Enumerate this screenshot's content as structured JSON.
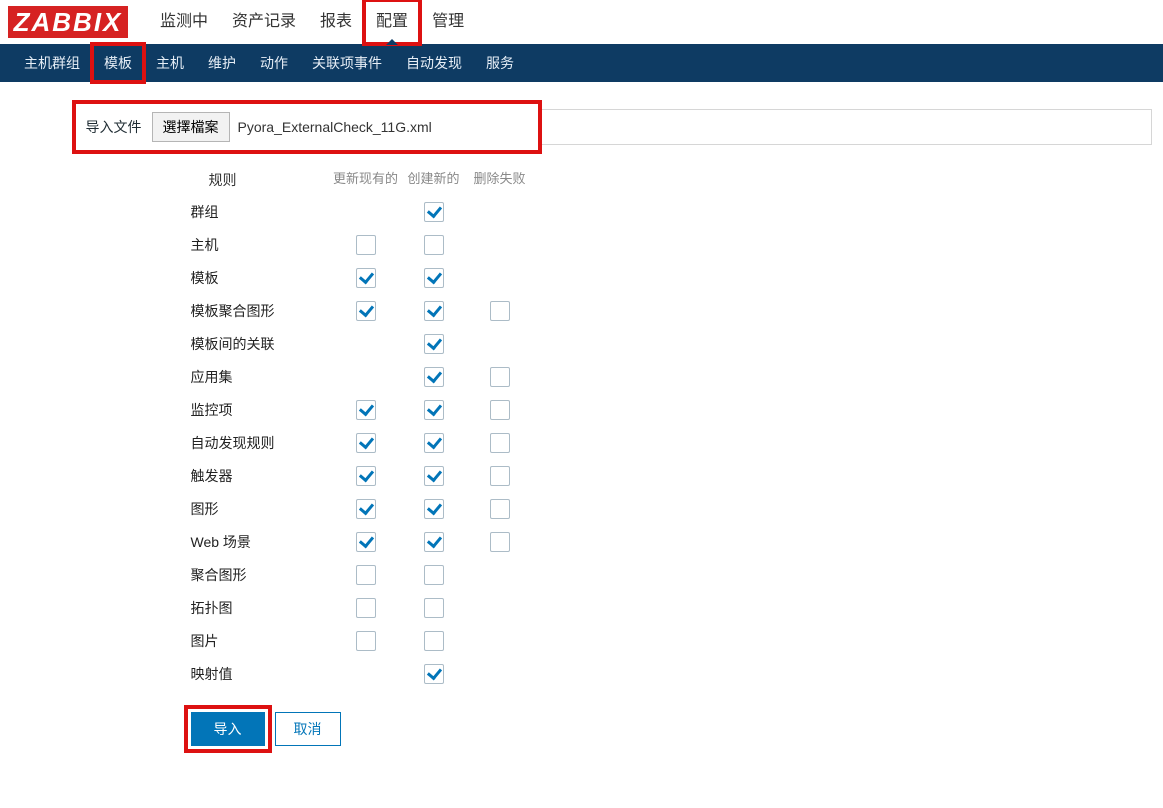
{
  "logo": "ZABBIX",
  "topnav": {
    "items": [
      "监测中",
      "资产记录",
      "报表",
      "配置",
      "管理"
    ],
    "activeIndex": 3,
    "highlightIndex": 3
  },
  "subnav": {
    "items": [
      "主机群组",
      "模板",
      "主机",
      "维护",
      "动作",
      "关联项事件",
      "自动发现",
      "服务"
    ],
    "highlightIndex": 1
  },
  "form": {
    "fileLabel": "导入文件",
    "chooseFileBtn": "選擇檔案",
    "chosenFileName": "Pyora_ExternalCheck_11G.xml",
    "rulesLabel": "规则",
    "headers": {
      "update": "更新现有的",
      "create": "创建新的",
      "delete": "删除失败"
    },
    "rules": [
      {
        "name": "群组",
        "update": null,
        "create": true,
        "delete": null
      },
      {
        "name": "主机",
        "update": false,
        "create": false,
        "delete": null
      },
      {
        "name": "模板",
        "update": true,
        "create": true,
        "delete": null
      },
      {
        "name": "模板聚合图形",
        "update": true,
        "create": true,
        "delete": false
      },
      {
        "name": "模板间的关联",
        "update": null,
        "create": true,
        "delete": null
      },
      {
        "name": "应用集",
        "update": null,
        "create": true,
        "delete": false
      },
      {
        "name": "监控项",
        "update": true,
        "create": true,
        "delete": false
      },
      {
        "name": "自动发现规则",
        "update": true,
        "create": true,
        "delete": false
      },
      {
        "name": "触发器",
        "update": true,
        "create": true,
        "delete": false
      },
      {
        "name": "图形",
        "update": true,
        "create": true,
        "delete": false
      },
      {
        "name": "Web 场景",
        "update": true,
        "create": true,
        "delete": false
      },
      {
        "name": "聚合图形",
        "update": false,
        "create": false,
        "delete": null
      },
      {
        "name": "拓扑图",
        "update": false,
        "create": false,
        "delete": null
      },
      {
        "name": "图片",
        "update": false,
        "create": false,
        "delete": null
      },
      {
        "name": "映射值",
        "update": null,
        "create": true,
        "delete": null
      }
    ],
    "importBtn": "导入",
    "cancelBtn": "取消"
  },
  "highlights": {
    "importBtn": true,
    "fileRow": true
  },
  "colors": {
    "accent": "#0275b8",
    "navbg": "#0E3B63",
    "highlight": "#d11"
  }
}
